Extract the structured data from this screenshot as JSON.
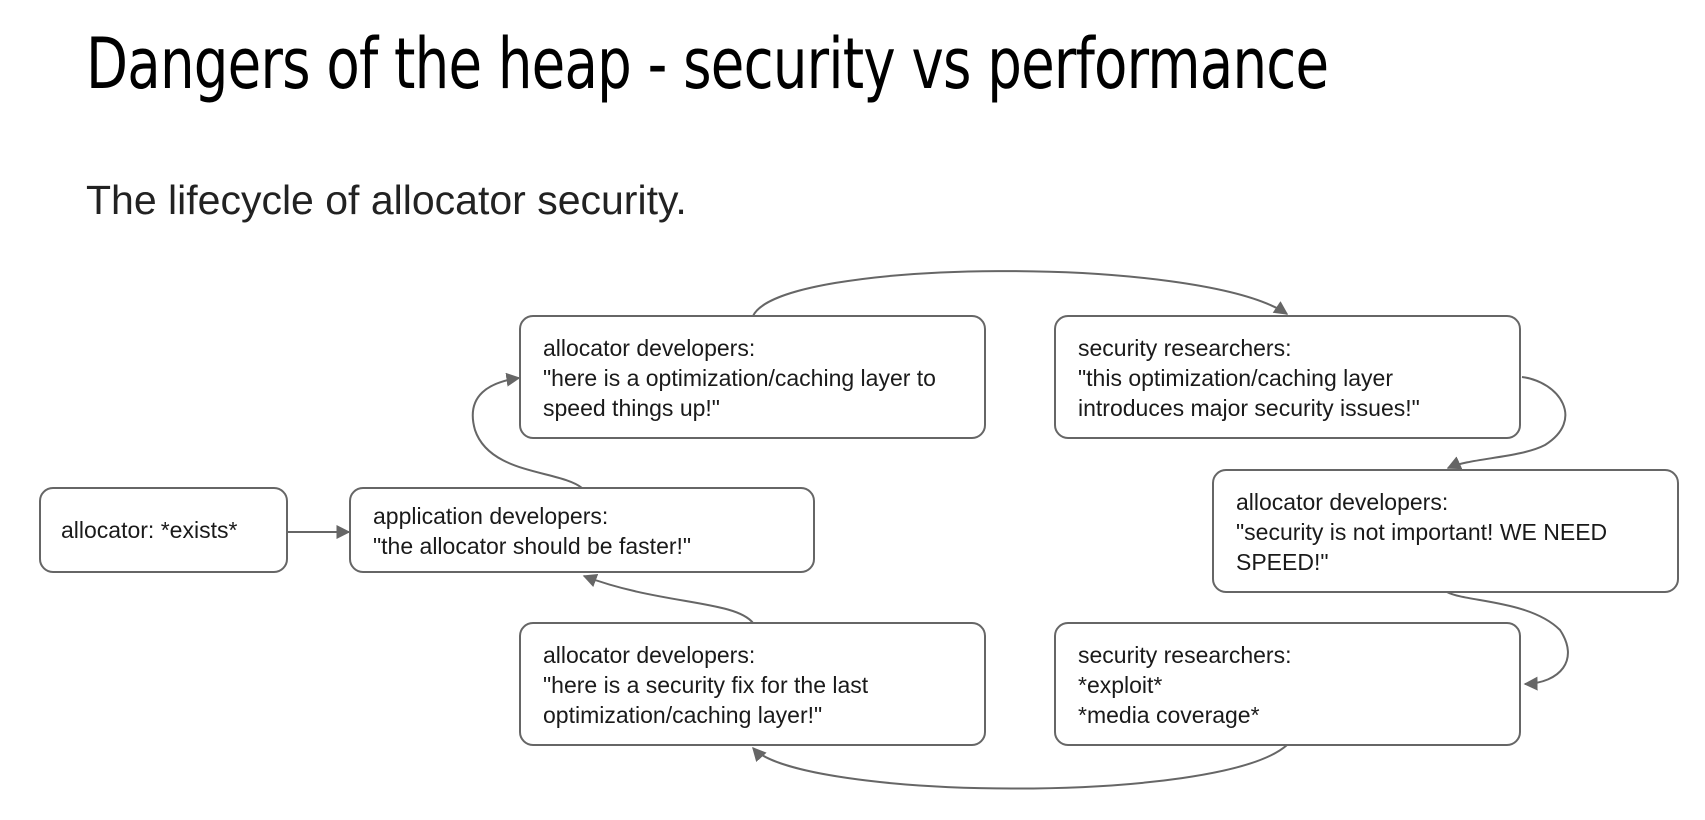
{
  "slide": {
    "title": "Dangers of the heap - security vs performance",
    "subtitle": "The lifecycle of allocator security."
  },
  "diagram": {
    "nodes": {
      "allocator_exists": {
        "lines": [
          "allocator: *exists*"
        ]
      },
      "application_developers": {
        "lines": [
          "application developers:",
          "\"the allocator should be faster!\""
        ]
      },
      "allocator_developers_optimization": {
        "lines": [
          "allocator developers:",
          "\"here is a optimization/caching layer to",
          "speed things up!\""
        ]
      },
      "security_researchers_issues": {
        "lines": [
          "security researchers:",
          "\"this optimization/caching layer",
          "introduces major security issues!\""
        ]
      },
      "allocator_developers_speed": {
        "lines": [
          "allocator developers:",
          "\"security is not important! WE NEED",
          "SPEED!\""
        ]
      },
      "security_researchers_exploit": {
        "lines": [
          "security researchers:",
          "*exploit*",
          "*media coverage*"
        ]
      },
      "allocator_developers_fix": {
        "lines": [
          "allocator developers:",
          "\"here is a security fix for the last",
          "optimization/caching layer!\""
        ]
      }
    },
    "colors": {
      "border": "#666666",
      "arrow": "#666666",
      "text": "#1a1a1a"
    }
  }
}
